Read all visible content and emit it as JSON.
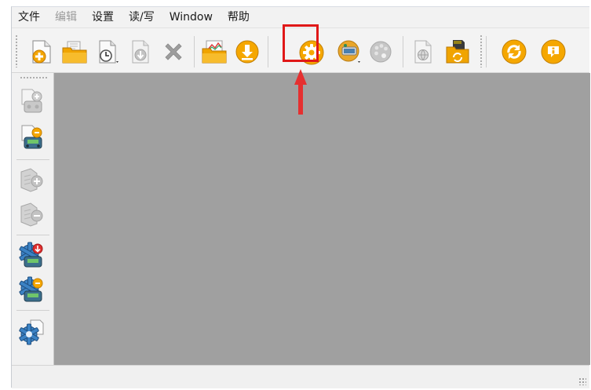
{
  "menu": {
    "items": [
      {
        "label": "文件",
        "enabled": true
      },
      {
        "label": "编辑",
        "enabled": false
      },
      {
        "label": "设置",
        "enabled": true
      },
      {
        "label": "读/写",
        "enabled": true
      },
      {
        "label": "Window",
        "enabled": true
      },
      {
        "label": "帮助",
        "enabled": true
      }
    ]
  },
  "toolbar": {
    "buttons": [
      {
        "name": "new-file-icon",
        "enabled": true
      },
      {
        "name": "open-folder-icon",
        "enabled": true
      },
      {
        "name": "timer-document-icon",
        "enabled": true
      },
      {
        "name": "download-document-icon",
        "enabled": false
      },
      {
        "name": "close-x-icon",
        "enabled": false
      },
      {
        "name": "chart-folder-icon",
        "enabled": true
      },
      {
        "name": "download-circle-icon",
        "enabled": true
      },
      {
        "name": "settings-gear-icon",
        "enabled": true,
        "highlighted": true
      },
      {
        "name": "receiver-settings-icon",
        "enabled": true
      },
      {
        "name": "palette-icon",
        "enabled": false
      },
      {
        "name": "document-globe-icon",
        "enabled": false
      },
      {
        "name": "sd-card-sync-icon",
        "enabled": true
      },
      {
        "name": "refresh-circle-icon",
        "enabled": true
      },
      {
        "name": "info-circle-icon",
        "enabled": true
      }
    ]
  },
  "sidebar": {
    "buttons": [
      {
        "name": "document-add-joystick-icon",
        "enabled": false
      },
      {
        "name": "document-joystick-icon",
        "enabled": true
      },
      {
        "name": "model-add-icon",
        "enabled": false
      },
      {
        "name": "model-sub-icon",
        "enabled": false
      },
      {
        "name": "gear-joystick-down-icon",
        "enabled": true
      },
      {
        "name": "gear-joystick-up-icon",
        "enabled": true
      },
      {
        "name": "gear-document-icon",
        "enabled": true
      }
    ]
  },
  "colors": {
    "workspace": "#a0a0a0",
    "highlight": "#e01818",
    "icon_orange": "#f5a700",
    "icon_disabled": "#b4b4b4"
  },
  "status": {
    "text": ""
  }
}
